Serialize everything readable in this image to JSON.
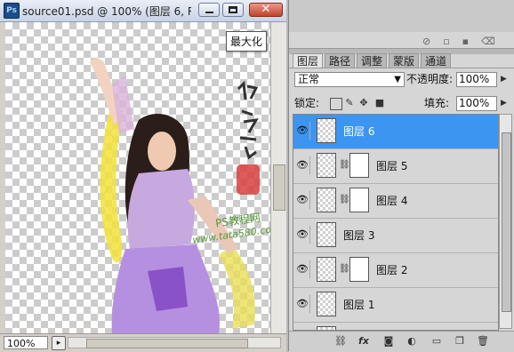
{
  "document": {
    "title": "source01.psd @ 100% (图层 6, R...",
    "app_icon": "Ps",
    "tooltip": "最大化",
    "zoom": "100%",
    "close_symbol": "✕"
  },
  "canvas_watermark": {
    "site_cn": "PS教程网",
    "site_url": "www.tata580.com"
  },
  "layers_panel": {
    "tabs": [
      {
        "label": "图层",
        "active": true
      },
      {
        "label": "路径",
        "active": false
      },
      {
        "label": "调整",
        "active": false
      },
      {
        "label": "蒙版",
        "active": false
      },
      {
        "label": "通道",
        "active": false
      }
    ],
    "blend_mode": "正常",
    "opacity_label": "不透明度:",
    "opacity_value": "100%",
    "lock_label": "锁定:",
    "fill_label": "填充:",
    "fill_value": "100%",
    "layers": [
      {
        "name": "图层 6",
        "selected": true,
        "has_mask": false
      },
      {
        "name": "图层 5",
        "selected": false,
        "has_mask": true
      },
      {
        "name": "图层 4",
        "selected": false,
        "has_mask": true
      },
      {
        "name": "图层 3",
        "selected": false,
        "has_mask": false
      },
      {
        "name": "图层 2",
        "selected": false,
        "has_mask": true
      },
      {
        "name": "图层 1",
        "selected": false,
        "has_mask": false
      }
    ],
    "bottom_icons": [
      "link-icon",
      "fx-icon",
      "mask-icon",
      "adjustment-icon",
      "group-icon",
      "new-layer-icon",
      "trash-icon"
    ],
    "fx_label": "fx"
  },
  "colors": {
    "selection": "#3d95f2",
    "titlebar": "#c9d3e4"
  }
}
